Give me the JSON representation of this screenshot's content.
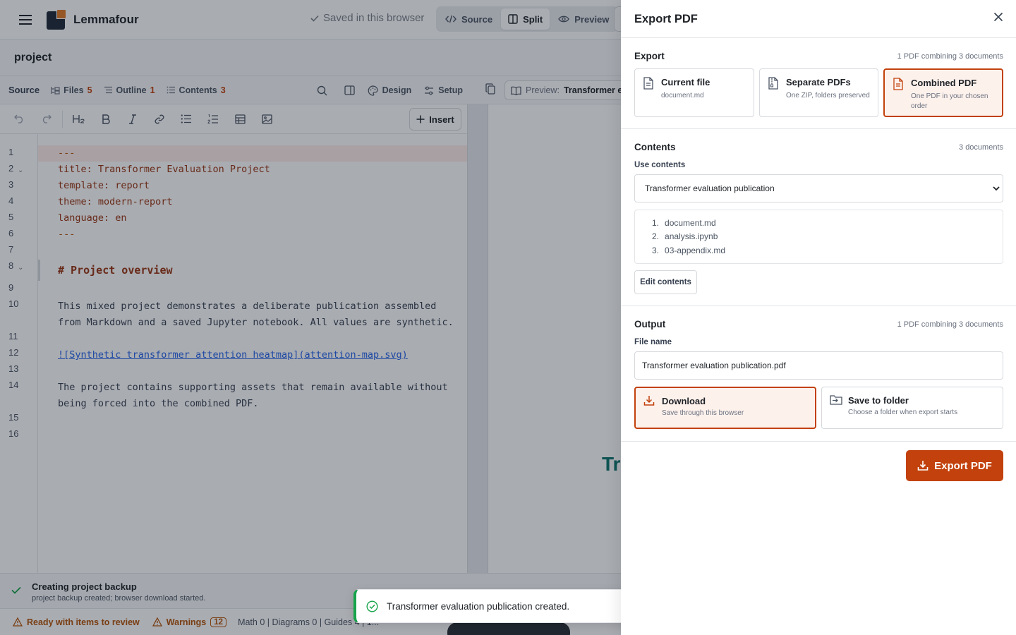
{
  "app": {
    "brand": "Lemmafour"
  },
  "project": {
    "name": "project",
    "saved_status": "Saved in this browser",
    "view_modes": [
      "Source",
      "Split",
      "Preview"
    ],
    "active_view": "Split"
  },
  "source_toolbar": {
    "label": "Source",
    "files_label": "Files",
    "files_count": "5",
    "outline_label": "Outline",
    "outline_count": "1",
    "contents_label": "Contents",
    "contents_count": "3",
    "design_label": "Design",
    "setup_label": "Setup"
  },
  "format_toolbar": {
    "insert_label": "Insert"
  },
  "editor": {
    "line_numbers": [
      "1",
      "2",
      "3",
      "4",
      "5",
      "6",
      "7",
      "8",
      "9",
      "10",
      "11",
      "12",
      "13",
      "14",
      "15",
      "16"
    ],
    "lines": {
      "l1": "---",
      "l2": "title: Transformer Evaluation Project",
      "l3": "template: report",
      "l4": "theme: modern-report",
      "l5": "language: en",
      "l6": "---",
      "l8": "# Project overview",
      "l10a": "This mixed project demonstrates a deliberate publication assembled",
      "l10b": "from Markdown and a saved Jupyter notebook. All values are synthetic.",
      "l12": "![Synthetic transformer attention heatmap](attention-map.svg)",
      "l14a": "The project contains supporting assets that remain available without",
      "l14b": "being forced into the combined PDF."
    }
  },
  "preview": {
    "chip_label": "Preview:",
    "chip_value": "Transformer ev",
    "title_fragment": "Tr"
  },
  "backup": {
    "title": "Creating project backup",
    "subtitle": "project backup created; browser download started."
  },
  "statusbar": {
    "ready": "Ready with items to review",
    "warnings_label": "Warnings",
    "warnings_count": "12",
    "stats": "Math 0 | Diagrams 0 | Guides 4 | 1..."
  },
  "toast": {
    "message": "Transformer evaluation publication created."
  },
  "export_panel": {
    "title": "Export PDF",
    "export_section": {
      "title": "Export",
      "meta": "1 PDF combining 3 documents",
      "options": [
        {
          "title": "Current file",
          "desc": "document.md",
          "selected": false,
          "icon": "file-icon"
        },
        {
          "title": "Separate PDFs",
          "desc": "One ZIP, folders preserved",
          "selected": false,
          "icon": "zip-file-icon"
        },
        {
          "title": "Combined PDF",
          "desc": "One PDF in your chosen order",
          "selected": true,
          "icon": "combined-file-icon"
        }
      ]
    },
    "contents_section": {
      "title": "Contents",
      "meta": "3 documents",
      "use_label": "Use contents",
      "selected_contents": "Transformer evaluation publication",
      "documents": [
        "document.md",
        "analysis.ipynb",
        "03-appendix.md"
      ],
      "edit_label": "Edit contents"
    },
    "output_section": {
      "title": "Output",
      "meta": "1 PDF combining 3 documents",
      "file_name_label": "File name",
      "file_name": "Transformer evaluation publication.pdf",
      "options": [
        {
          "title": "Download",
          "desc": "Save through this browser",
          "selected": true,
          "icon": "download-icon"
        },
        {
          "title": "Save to folder",
          "desc": "Choose a folder when export starts",
          "selected": false,
          "icon": "folder-icon"
        }
      ]
    },
    "export_button": "Export PDF"
  },
  "colors": {
    "accent": "#c2410c",
    "accent_soft": "#fdf1ec",
    "teal_title": "#0f766e",
    "success": "#16a34a",
    "overlay": "rgba(17,24,39,0.36)"
  }
}
